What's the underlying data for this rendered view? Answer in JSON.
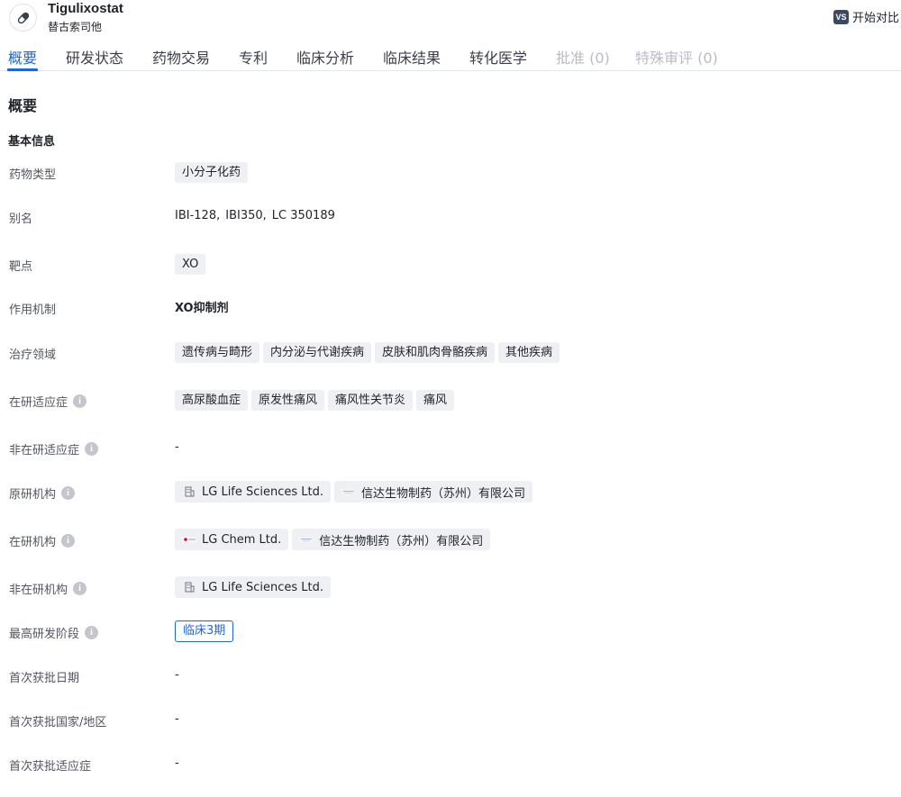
{
  "header": {
    "drug_name": "Tigulixostat",
    "drug_cn": "替古索司他",
    "compare_badge": "VS",
    "compare_label": "开始对比"
  },
  "tabs": [
    {
      "label": "概要",
      "state": "active"
    },
    {
      "label": "研发状态",
      "state": "normal"
    },
    {
      "label": "药物交易",
      "state": "normal"
    },
    {
      "label": "专利",
      "state": "normal"
    },
    {
      "label": "临床分析",
      "state": "normal"
    },
    {
      "label": "临床结果",
      "state": "normal"
    },
    {
      "label": "转化医学",
      "state": "normal"
    },
    {
      "label": "批准 (0)",
      "state": "disabled"
    },
    {
      "label": "特殊审评 (0)",
      "state": "disabled"
    }
  ],
  "section_title": "概要",
  "sub_title": "基本信息",
  "info_icon": "i",
  "rows": {
    "drug_type": {
      "label": "药物类型",
      "tags": [
        "小分子化药"
      ]
    },
    "alias": {
      "label": "别名",
      "values": [
        "IBI-128,",
        "IBI350,",
        "LC 350189"
      ]
    },
    "target": {
      "label": "靶点",
      "tags": [
        "XO"
      ]
    },
    "mechanism": {
      "label": "作用机制",
      "value": "XO抑制剂"
    },
    "therapeutic_area": {
      "label": "治疗领域",
      "tags": [
        "遗传病与畸形",
        "内分泌与代谢疾病",
        "皮肤和肌肉骨骼疾病",
        "其他疾病"
      ]
    },
    "active_indication": {
      "label": "在研适应症",
      "tags": [
        "高尿酸血症",
        "原发性痛风",
        "痛风性关节炎",
        "痛风"
      ]
    },
    "inactive_indication": {
      "label": "非在研适应症",
      "value": "-"
    },
    "originator": {
      "label": "原研机构",
      "orgs": [
        "LG Life Sciences Ltd.",
        "信达生物制药（苏州）有限公司"
      ]
    },
    "active_org": {
      "label": "在研机构",
      "orgs": [
        "LG Chem Ltd.",
        "信达生物制药（苏州）有限公司"
      ]
    },
    "inactive_org": {
      "label": "非在研机构",
      "orgs": [
        "LG Life Sciences Ltd."
      ]
    },
    "highest_phase": {
      "label": "最高研发阶段",
      "value": "临床3期"
    },
    "first_approval_date": {
      "label": "首次获批日期",
      "value": "-"
    },
    "first_approval_country": {
      "label": "首次获批国家/地区",
      "value": "-"
    },
    "first_approval_indication": {
      "label": "首次获批适应症",
      "value": "-"
    }
  },
  "colors": {
    "accent": "#1f66d6",
    "tag_bg": "#eef0f3",
    "disabled": "#b8bcc4"
  }
}
